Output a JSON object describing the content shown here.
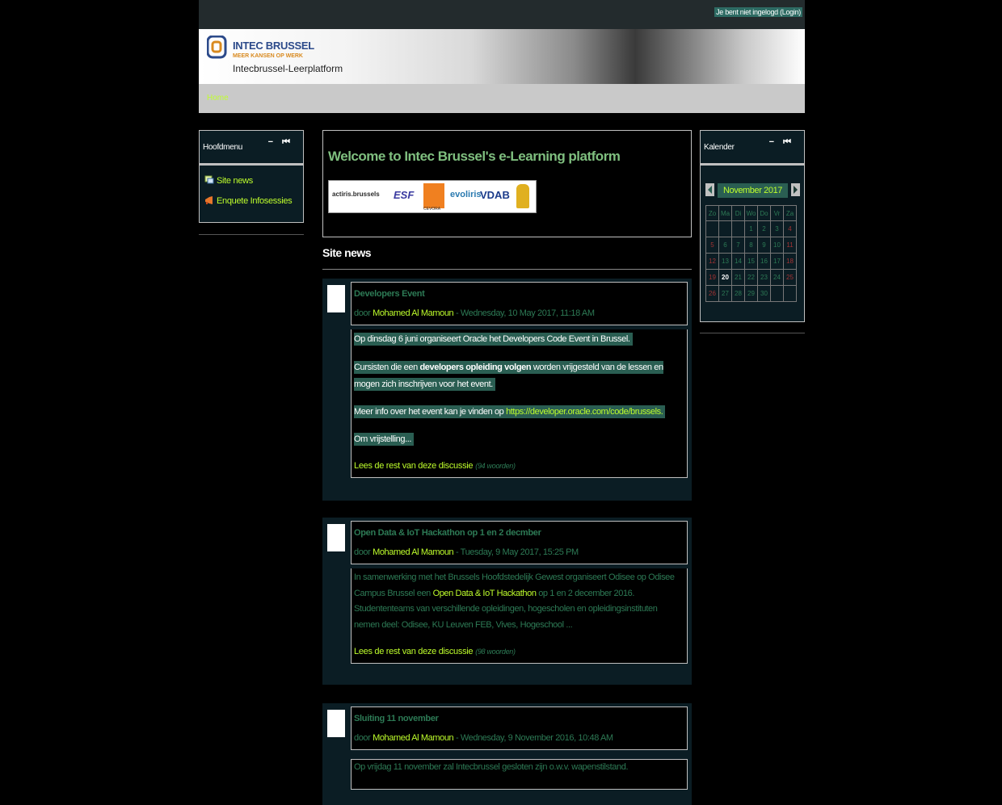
{
  "topbar": {
    "login_text": "Je bent niet ingelogd (Login)"
  },
  "banner": {
    "org_name": "INTEC BRUSSEL",
    "tagline": "MEER KANSEN OP WERK",
    "platform_name": "Intecbrussel-Leerplatform"
  },
  "nav": {
    "home": "Home"
  },
  "main_menu": {
    "title": "Hoofdmenu",
    "controls": "− ⏮",
    "items": [
      {
        "label": "Site news",
        "icon": "forum-icon"
      },
      {
        "label": "Enquete Infosessies",
        "icon": "megaphone-icon"
      }
    ]
  },
  "welcome": {
    "title": "Welcome to Intec Brussel's e-Learning platform",
    "partners": [
      "actiris.brussels",
      "ESF",
      "CEVORA",
      "evoliris",
      "VDAB",
      "Brussels iris"
    ]
  },
  "site_news": {
    "heading": "Site news",
    "posts": [
      {
        "subject": "Developers Event",
        "by": "door",
        "author": "Mohamed Al Mamoun",
        "date": "- Wednesday, 10 May 2017, 11:18 AM",
        "p1": "Op dinsdag 6 juni organiseert Oracle het Developers Code Event in Brussel.",
        "p2_pre": "Cursisten die een ",
        "p2_bold": "developers opleiding volgen",
        "p2_post": " worden vrijgesteld van de lessen en mogen zich inschrijven voor het event.",
        "p3_pre": "Meer info over het event kan je vinden op ",
        "p3_link": "https://developer.oracle.com/code/brussels.",
        "p4": "Om vrijstelling...",
        "read_more": "Lees de rest van deze discussie",
        "word_count": "(94 woorden)"
      },
      {
        "subject": "Open Data & IoT Hackathon op 1 en 2 decmber",
        "by": "door",
        "author": "Mohamed Al Mamoun",
        "date": "- Tuesday, 9 May 2017, 15:25 PM",
        "p1_pre": "In samenwerking met het Brussels Hoofdstedelijk Gewest organiseert Odisee op Odisee Campus Brussel een ",
        "p1_link": "Open Data & IoT Hackathon",
        "p1_post": " op 1 en 2 december 2016.",
        "p2": "Studententeams van verschillende opleidingen, hogescholen en opleidingsinstituten nemen deel: Odisee, KU Leuven FEB, Vives, Hogeschool ...",
        "read_more": "Lees de rest van deze discussie",
        "word_count": "(98 woorden)"
      },
      {
        "subject": "Sluiting 11 november",
        "by": "door",
        "author": "Mohamed Al Mamoun",
        "date": "- Wednesday, 9 November 2016, 10:48 AM",
        "p1": "Op vrijdag 11 november zal Intecbrussel gesloten zijn o.w.v. wapenstilstand."
      }
    ]
  },
  "calendar": {
    "title": "Kalender",
    "controls": "− ⏮",
    "month": "November 2017",
    "day_headers": [
      "Zo",
      "Ma",
      "Di",
      "Wo",
      "Do",
      "Vr",
      "Za"
    ],
    "weeks": [
      [
        "",
        "",
        "",
        "1",
        "2",
        "3",
        "4"
      ],
      [
        "5",
        "6",
        "7",
        "8",
        "9",
        "10",
        "11"
      ],
      [
        "12",
        "13",
        "14",
        "15",
        "16",
        "17",
        "18"
      ],
      [
        "19",
        "20",
        "21",
        "22",
        "23",
        "24",
        "25"
      ],
      [
        "26",
        "27",
        "28",
        "29",
        "30",
        "",
        ""
      ]
    ],
    "today": "20",
    "weekend_color": "#a33333",
    "accent_color": "#bfff2c"
  }
}
